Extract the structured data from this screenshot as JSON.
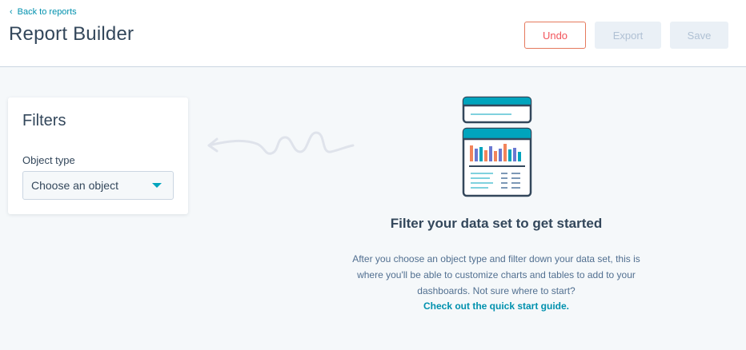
{
  "header": {
    "back_link": "Back to reports",
    "title": "Report Builder",
    "buttons": {
      "undo": "Undo",
      "export": "Export",
      "save": "Save"
    }
  },
  "filters": {
    "title": "Filters",
    "object_type_label": "Object type",
    "object_type_placeholder": "Choose an object"
  },
  "empty_state": {
    "title": "Filter your data set to get started",
    "body": "After you choose an object type and filter down your data set, this is where you'll be able to customize charts and tables to add to your dashboards. Not sure where to start?",
    "link": "Check out the quick start guide."
  },
  "colors": {
    "teal": "#00a4bd",
    "link": "#0091ae",
    "undo_border": "#e5795d",
    "text": "#33475b",
    "background": "#f5f8fa"
  },
  "icons": {
    "back": "chevron-left-icon",
    "select": "caret-down-icon",
    "arrow": "squiggle-arrow-icon",
    "illustration": "report-illustration"
  }
}
